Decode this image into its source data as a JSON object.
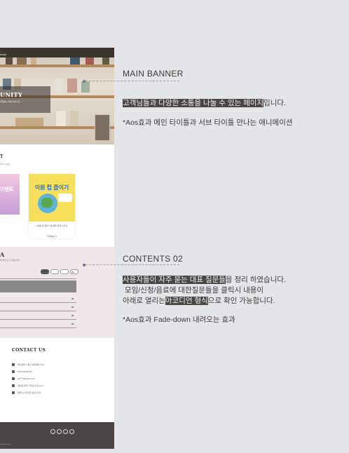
{
  "mockup": {
    "hero": {
      "nav_line1": "...",
      "nav_line2": "MORE",
      "title": "UNITY",
      "subtitle": "지원하는 페이지입니다."
    },
    "event": {
      "heading": "T",
      "subheading": "참여 이벤트",
      "card1_title": "이벤트",
      "card2_title": "이원 컵 줍이기",
      "card2_caption": "1회용 컵 줍이기 환경을 지켜 나가요",
      "card2_more": "자세히보기"
    },
    "faq": {
      "heading": "A",
      "subheading": "을 확인할 수 있습니다.",
      "tabs": [
        "전체",
        "모임",
        "신청",
        "음료"
      ]
    },
    "contact": {
      "heading": "CONTACT US",
      "address": "부산광역시 동구 중앙대로 214",
      "phone": "010-1234-5678",
      "email": "gd****@naver.com",
      "hours": "월요일 휴무 / 화-일 오전 11시",
      "extra": "영업시간 및 정기휴무 안내"
    },
    "footer": {
      "copyright": "all rights reserved"
    }
  },
  "annotations": [
    {
      "title": "MAIN BANNER",
      "lines": [
        [
          {
            "text": "고객님들과 다양한 소통을 나눌 수 있는 페이지",
            "hl": true
          },
          {
            "text": "입니다.",
            "hl": false
          }
        ],
        [
          {
            "text": "",
            "hl": false
          }
        ],
        [
          {
            "text": "*Aos효과 메인 타이틀과 서브 타이틀 만나는 애니메이션",
            "hl": false
          }
        ]
      ]
    },
    {
      "title": "CONTENTS 02",
      "lines": [
        [
          {
            "text": "사용자들이 자주 묻는 대표 질문들",
            "hl": true
          },
          {
            "text": "을 정리 하였습니다.",
            "hl": false
          }
        ],
        [
          {
            "text": " 모임/신청/음료에 대한질문들을 클릭시 내용이",
            "hl": false
          }
        ],
        [
          {
            "text": "아래로 열리는",
            "hl": false
          },
          {
            "text": "아코디언 형식",
            "hl": true
          },
          {
            "text": "으로 확인 가능합니다.",
            "hl": false
          }
        ],
        [
          {
            "text": "",
            "hl": false
          }
        ],
        [
          {
            "text": "*Aos효과 Fade-down 내려오는 효과",
            "hl": false
          }
        ]
      ]
    }
  ],
  "colors": {
    "background": "#e4e5e9",
    "highlight": "#4a4646",
    "faq_bg": "#f0e8e8",
    "footer": "#4a4646"
  }
}
